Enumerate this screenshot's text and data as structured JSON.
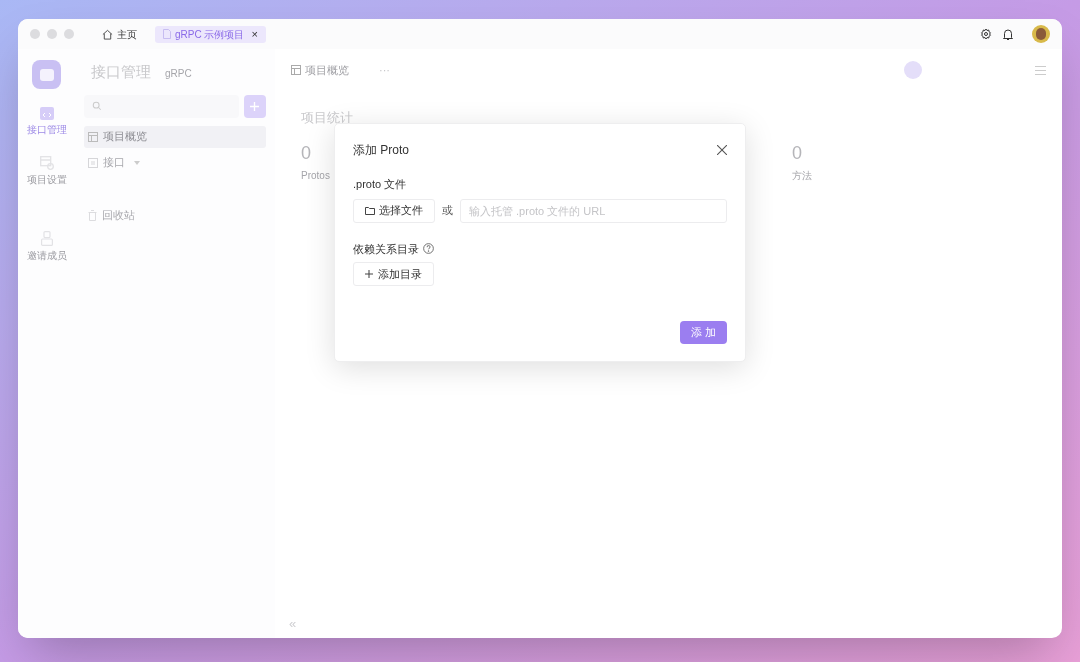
{
  "window": {
    "tabs": [
      {
        "kind": "home",
        "label": "主页",
        "selected": false
      },
      {
        "kind": "project",
        "label": "gRPC 示例项目",
        "selected": true,
        "close": "×"
      }
    ]
  },
  "rail": {
    "items": [
      {
        "kind": "api",
        "label": "接口管理",
        "selected": true
      },
      {
        "kind": "settings",
        "label": "项目设置",
        "selected": false
      },
      {
        "kind": "invite",
        "label": "邀请成员",
        "selected": false
      }
    ]
  },
  "sidebar": {
    "title": "接口管理",
    "subtitle": "gRPC",
    "items": [
      {
        "kind": "overview",
        "label": "项目概览",
        "selected": true
      },
      {
        "kind": "folder",
        "label": "接口",
        "selected": false,
        "expanded": false
      },
      {
        "kind": "trash",
        "label": "回收站",
        "selected": false
      }
    ]
  },
  "main": {
    "tab": "项目概览",
    "more": "···",
    "section_title": "项目统计",
    "stats": [
      {
        "value": "0",
        "label": "Protos"
      },
      {
        "value": "0",
        "label": "方法"
      }
    ],
    "collapse": "«"
  },
  "dialog": {
    "title": "添加 Proto",
    "file_label": ".proto 文件",
    "choose_button": "选择文件",
    "or": "或",
    "url_placeholder": "输入托管 .proto 文件的 URL",
    "deps_label": "依赖关系目录",
    "add_dir_button": "添加目录",
    "submit": "添 加"
  }
}
